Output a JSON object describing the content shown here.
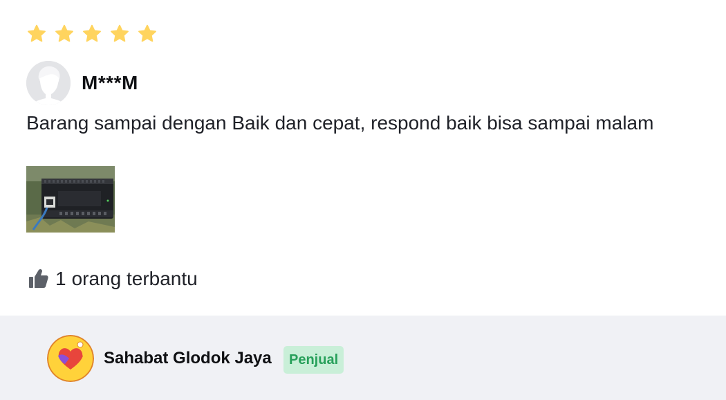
{
  "review": {
    "rating": 5,
    "rating_max": 5,
    "star_color": "#ffd45e",
    "reviewer": {
      "name": "M***M",
      "avatar_icon": "user-avatar-placeholder"
    },
    "text": "Barang sampai dengan Baik dan cepat, respond baik bisa sampai malam",
    "photo_icon": "product-photo-plc-module",
    "helpful": {
      "icon": "thumbs-up-icon",
      "count": "1",
      "label": "orang terbantu"
    }
  },
  "seller": {
    "name": "Sahabat Glodok Jaya",
    "badge": "Penjual",
    "badge_bg": "#c9efd8",
    "badge_color": "#27a05a",
    "logo_icon": "handshake-heart-logo"
  },
  "colors": {
    "seller_bar_bg": "#f0f1f5",
    "text": "#1f2128"
  }
}
